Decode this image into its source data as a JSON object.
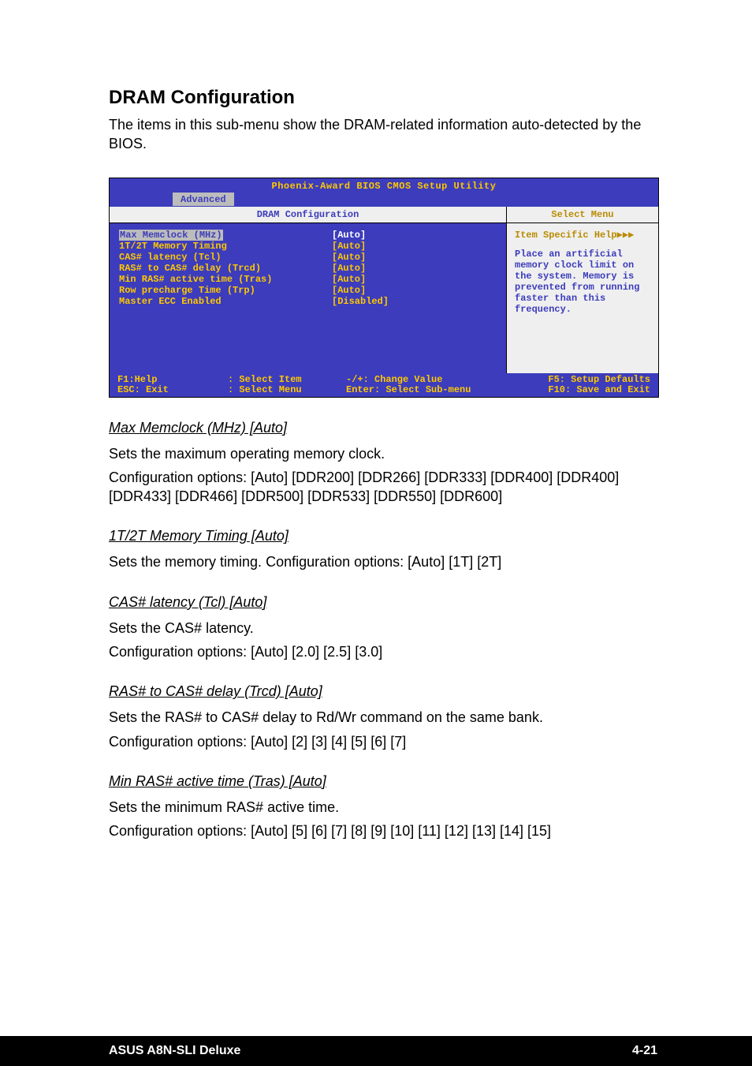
{
  "header": {
    "title": "DRAM Configuration",
    "intro": "The items in this sub-menu show the DRAM-related information auto-detected by the BIOS."
  },
  "bios": {
    "title": "Phoenix-Award BIOS CMOS Setup Utility",
    "tab": "Advanced",
    "left_header": "DRAM Configuration",
    "right_header": "Select Menu",
    "items": [
      {
        "label": "Max Memclock (MHz)",
        "value": "[Auto]",
        "selected": true
      },
      {
        "label": "1T/2T Memory Timing",
        "value": "[Auto]",
        "selected": false
      },
      {
        "label": "CAS# latency (Tcl)",
        "value": "[Auto]",
        "selected": false
      },
      {
        "label": "RAS# to CAS# delay (Trcd)",
        "value": "[Auto]",
        "selected": false
      },
      {
        "label": "Min RAS# active time (Tras)",
        "value": "[Auto]",
        "selected": false
      },
      {
        "label": "Row precharge Time (Trp)",
        "value": "[Auto]",
        "selected": false
      },
      {
        "label": "Master ECC Enabled",
        "value": "[Disabled]",
        "selected": false
      }
    ],
    "help_head": "Item Specific Help▶▶▶",
    "help_body": "Place an artificial memory clock limit on the system. Memory is prevented from running faster than this frequency.",
    "footer": {
      "c1a": "F1:Help",
      "c1b": "ESC: Exit",
      "c2a": ": Select Item",
      "c2b": ": Select Menu",
      "c3a": "-/+: Change Value",
      "c3b": "Enter: Select Sub-menu",
      "c4a": "F5: Setup Defaults",
      "c4b": "F10: Save and Exit"
    }
  },
  "sections": [
    {
      "head": "Max Memclock (MHz) [Auto]",
      "body": "Sets the maximum operating memory clock.\nConfiguration options: [Auto] [DDR200] [DDR266] [DDR333] [DDR400] [DDR400] [DDR433] [DDR466] [DDR500] [DDR533] [DDR550] [DDR600]"
    },
    {
      "head": "1T/2T Memory Timing [Auto]",
      "body": "Sets the memory timing. Configuration options: [Auto] [1T] [2T]"
    },
    {
      "head": "CAS# latency (Tcl) [Auto]",
      "body": "Sets the CAS# latency.\nConfiguration options: [Auto] [2.0] [2.5] [3.0]"
    },
    {
      "head": "RAS# to CAS# delay (Trcd) [Auto]",
      "body": "Sets the RAS# to CAS# delay to Rd/Wr command on the same bank.\nConfiguration options: [Auto] [2] [3] [4] [5] [6] [7]"
    },
    {
      "head": "Min RAS# active time (Tras) [Auto]",
      "body": "Sets the minimum RAS# active time.\nConfiguration options: [Auto] [5] [6] [7] [8] [9] [10] [11] [12] [13] [14] [15]"
    }
  ],
  "page_footer": {
    "left": "ASUS A8N-SLI Deluxe",
    "right": "4-21"
  }
}
